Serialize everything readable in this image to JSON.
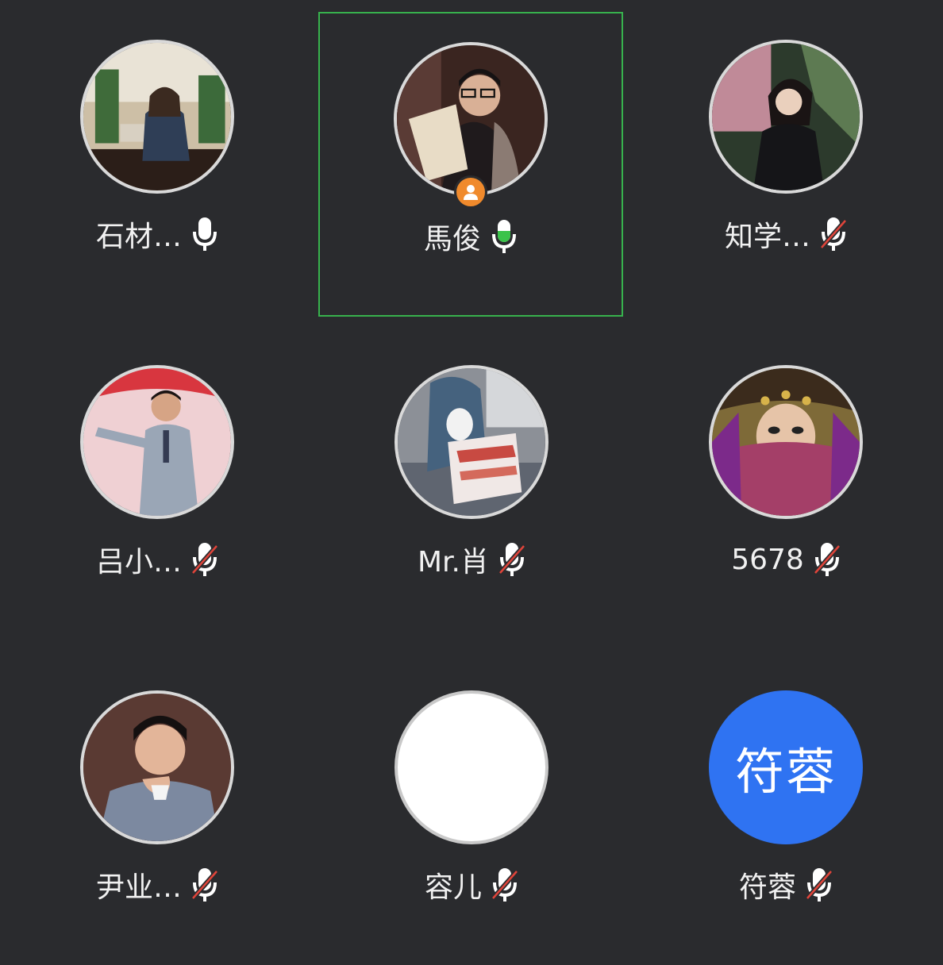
{
  "participants": [
    {
      "name": "石材…",
      "mic": "on"
    },
    {
      "name": "馬俊",
      "mic": "speaking",
      "host": true,
      "active": true
    },
    {
      "name": "知学…",
      "mic": "muted"
    },
    {
      "name": "吕小…",
      "mic": "muted"
    },
    {
      "name": "Mr.肖",
      "mic": "muted"
    },
    {
      "name": "5678",
      "mic": "muted"
    },
    {
      "name": "尹业…",
      "mic": "muted"
    },
    {
      "name": "容儿",
      "mic": "muted"
    },
    {
      "name": "符蓉",
      "mic": "muted",
      "avatar_text": "符蓉"
    }
  ],
  "colors": {
    "background": "#2a2b2e",
    "active_border": "#37b24d",
    "speaking_mic": "#3ac34a",
    "muted_slash": "#e0443a",
    "host_badge": "#f08a2c",
    "text_avatar": "#2f73f2"
  }
}
